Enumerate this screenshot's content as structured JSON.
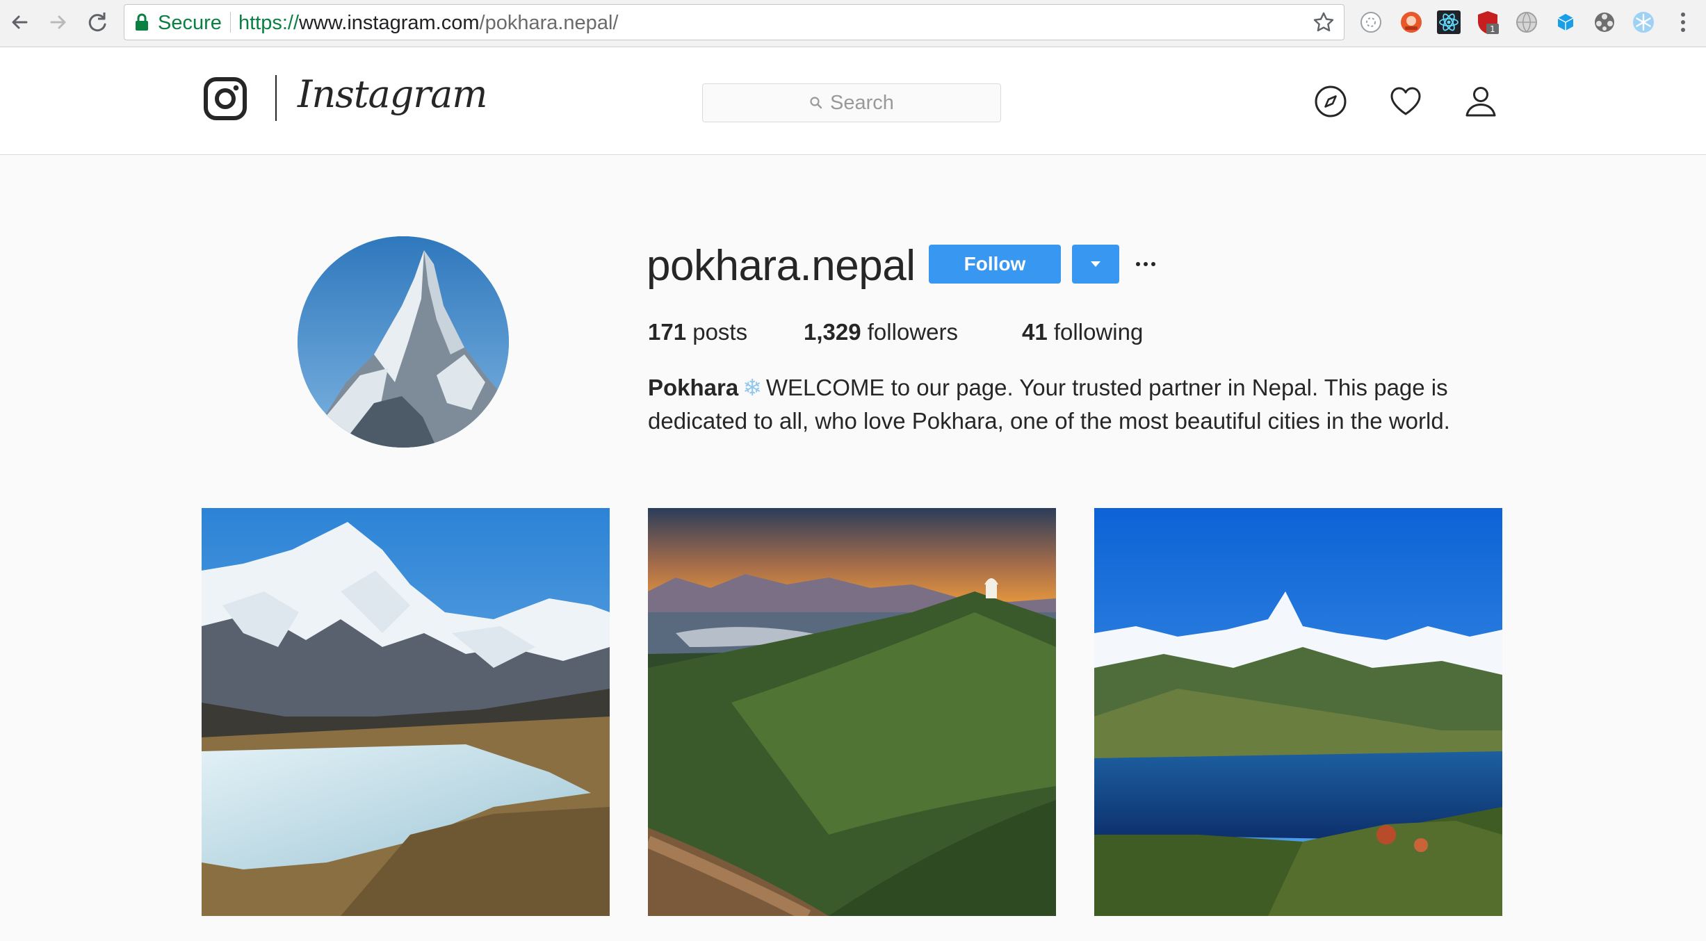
{
  "browser": {
    "secure_label": "Secure",
    "url_scheme": "https://",
    "url_host": "www.instagram.com",
    "url_path": "/pokhara.nepal/",
    "extensions": [
      "ring-extension-icon",
      "opera-extension-icon",
      "react-devtools-icon",
      "ublock-icon",
      "globe-extension-icon",
      "cube-extension-icon",
      "film-extension-icon",
      "snowflake-extension-icon"
    ],
    "extension_badge": "1"
  },
  "header": {
    "brand": "Instagram",
    "search_placeholder": "Search"
  },
  "profile": {
    "username": "pokhara.nepal",
    "follow_label": "Follow",
    "stats": {
      "posts_count": "171",
      "posts_label": " posts",
      "followers_count": "1,329",
      "followers_label": " followers",
      "following_count": "41",
      "following_label": " following"
    },
    "bio_name": "Pokhara",
    "bio_emoji": "❄",
    "bio_text": "WELCOME to our page. Your trusted partner in Nepal. This page is dedicated to all, who love Pokhara, one of the most beautiful cities in the world."
  },
  "colors": {
    "accent": "#3897f0",
    "secure_green": "#0b8043"
  }
}
